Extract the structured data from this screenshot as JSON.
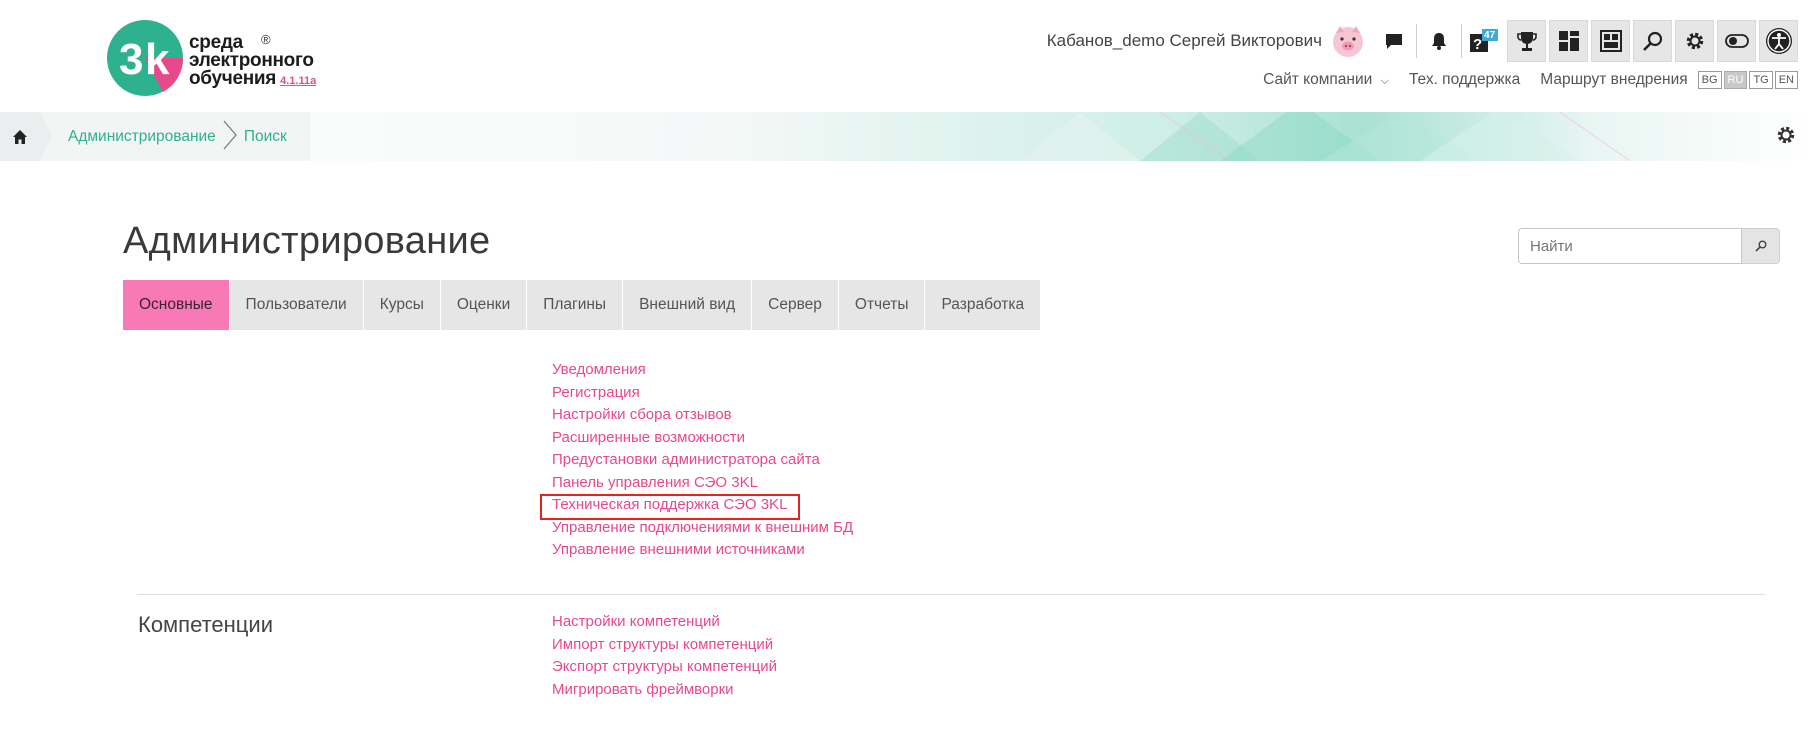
{
  "logo": {
    "line1": "среда",
    "line2": "электронного",
    "line3": "обучения",
    "version": "4.1.11a",
    "reg_mark": "®"
  },
  "header": {
    "user_name": "Кабанов_demo Сергей Викторович",
    "badge_count": "47",
    "links": {
      "company_site": "Сайт компании",
      "support": "Тех. поддержка",
      "route": "Маршрут внедрения"
    },
    "languages": [
      "BG",
      "RU",
      "TG",
      "EN"
    ],
    "active_language": "RU",
    "icons": [
      "messages-icon",
      "bell-icon",
      "help-icon",
      "trophy-icon",
      "dashboard-icon",
      "gallery-icon",
      "search-icon",
      "gear-icon",
      "toggle-icon",
      "accessibility-icon"
    ]
  },
  "breadcrumb": {
    "items": [
      "Администрирование",
      "Поиск"
    ]
  },
  "page": {
    "title": "Администрирование",
    "search_placeholder": "Найти"
  },
  "tabs": [
    "Основные",
    "Пользователи",
    "Курсы",
    "Оценки",
    "Плагины",
    "Внешний вид",
    "Сервер",
    "Отчеты",
    "Разработка"
  ],
  "active_tab": "Основные",
  "general_links": [
    "Уведомления",
    "Регистрация",
    "Настройки сбора отзывов",
    "Расширенные возможности",
    "Предустановки администратора сайта",
    "Панель управления СЭО 3KL",
    "Техническая поддержка СЭО 3KL",
    "Управление подключениями к внешним БД",
    "Управление внешними источниками"
  ],
  "highlighted_link": "Техническая поддержка СЭО 3KL",
  "competencies": {
    "title": "Компетенции",
    "links": [
      "Настройки компетенций",
      "Импорт структуры компетенций",
      "Экспорт структуры компетенций",
      "Мигрировать фреймворки"
    ]
  },
  "colors": {
    "brand_green": "#2eb18e",
    "brand_pink": "#e8488c",
    "active_tab": "#f779b5",
    "highlight": "#e32222"
  }
}
